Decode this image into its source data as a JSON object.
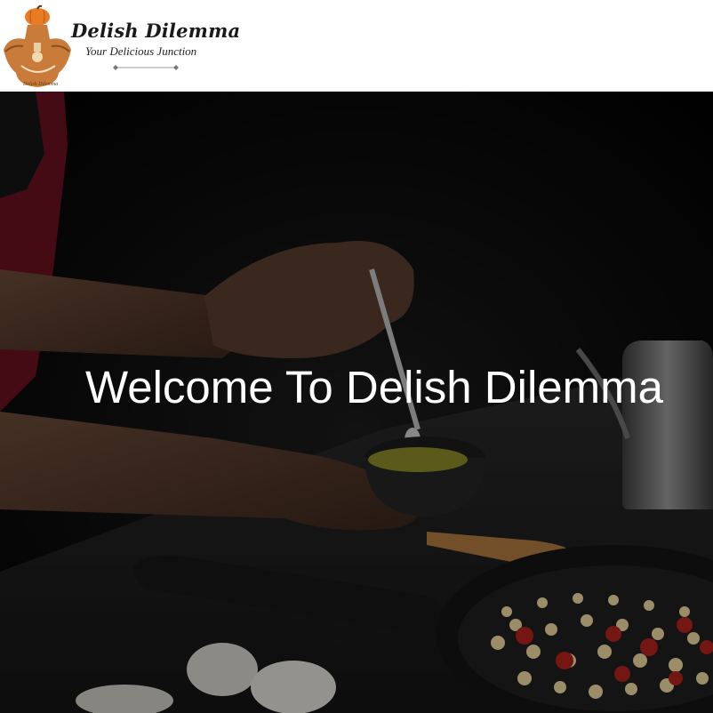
{
  "header": {
    "logo": {
      "site_name": "Delish Dilemma",
      "tagline": "Your Delicious Junction",
      "icon": "chef-apron-pumpkin-logo"
    }
  },
  "hero": {
    "title": "Welcome To Delish Dilemma",
    "background_image": "hands-plating-pesto-over-pasta-pan-photo"
  },
  "colors": {
    "header_bg": "#ffffff",
    "hero_text": "#ffffff",
    "logo_orange": "#e87b24",
    "apron_brown": "#c97b3a"
  }
}
